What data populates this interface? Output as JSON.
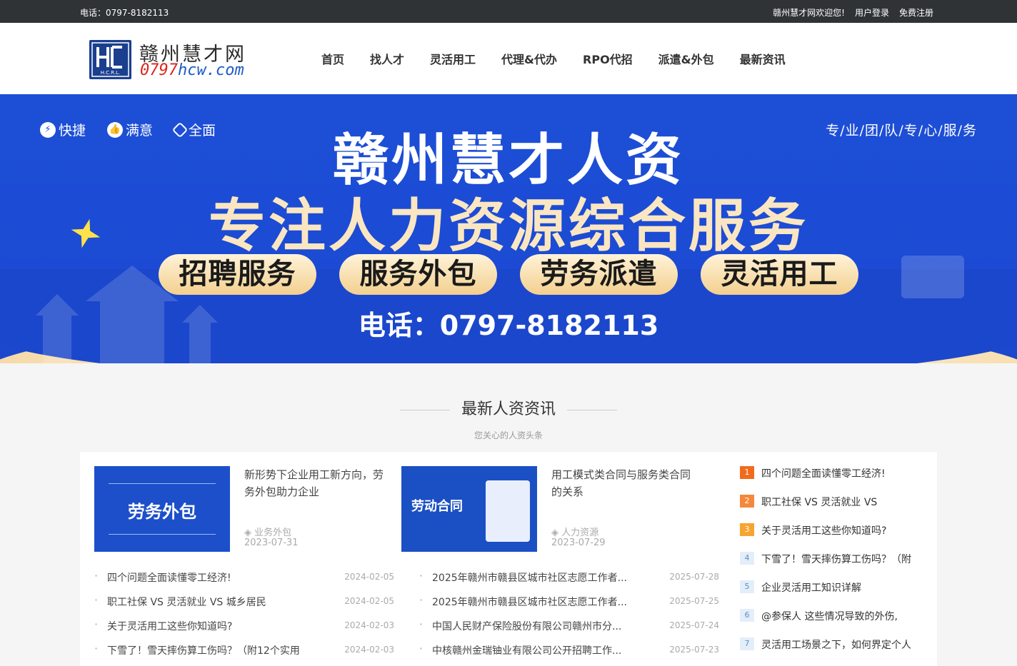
{
  "topbar": {
    "phone": "电话：0797-8182113",
    "welcome": "赣州慧才网欢迎您!",
    "login": "用户登录",
    "register": "免费注册"
  },
  "logo": {
    "cn": "赣州慧才网",
    "en_prefix": "0797",
    "en_suffix": "hcw.com",
    "mark": "H.C.R.L."
  },
  "nav": [
    "首页",
    "找人才",
    "灵活用工",
    "代理&代办",
    "RPO代招",
    "派遣&外包",
    "最新资讯"
  ],
  "banner": {
    "badges": [
      "快捷",
      "满意",
      "全面"
    ],
    "slogan": "专/业/团/队/专/心/服/务",
    "title": "赣州慧才人资",
    "subtitle": "专注人力资源综合服务",
    "services": [
      "招聘服务",
      "服务外包",
      "劳务派遣",
      "灵活用工"
    ],
    "phone": "电话：0797-8182113"
  },
  "section": {
    "title": "最新人资资讯",
    "subtitle": "您关心的人资头条"
  },
  "featured": [
    {
      "thumb_label": "劳务外包",
      "title": "新形势下企业用工新方向，劳务外包助力企业",
      "category": "业务外包",
      "date": "2023-07-31"
    },
    {
      "thumb_label": "劳动合同",
      "title": "用工模式类合同与服务类合同的关系",
      "category": "人力资源",
      "date": "2023-07-29"
    }
  ],
  "list_left": [
    {
      "title": "四个问题全面读懂零工经济!",
      "date": "2024-02-05"
    },
    {
      "title": "职工社保 VS 灵活就业 VS 城乡居民",
      "date": "2024-02-05"
    },
    {
      "title": "关于灵活用工这些你知道吗?",
      "date": "2024-02-03"
    },
    {
      "title": "下雪了！雪天摔伤算工伤吗？（附12个实用",
      "date": "2024-02-03"
    }
  ],
  "list_mid": [
    {
      "title": "2025年赣州市赣县区城市社区志愿工作者...",
      "date": "2025-07-28"
    },
    {
      "title": "2025年赣州市赣县区城市社区志愿工作者...",
      "date": "2025-07-25"
    },
    {
      "title": "中国人民财产保险股份有限公司赣州市分...",
      "date": "2025-07-24"
    },
    {
      "title": "中核赣州金瑞铀业有限公司公开招聘工作...",
      "date": "2025-07-23"
    }
  ],
  "ranking": [
    {
      "n": "1",
      "title": "四个问题全面读懂零工经济!",
      "color": "#f26b1d"
    },
    {
      "n": "2",
      "title": "职工社保 VS 灵活就业 VS",
      "color": "#f5883a"
    },
    {
      "n": "3",
      "title": "关于灵活用工这些你知道吗?",
      "color": "#f7a431"
    },
    {
      "n": "4",
      "title": "下雪了！雪天摔伤算工伤吗？（附",
      "color": "#e3eef9"
    },
    {
      "n": "5",
      "title": "企业灵活用工知识详解",
      "color": "#e3eef9"
    },
    {
      "n": "6",
      "title": "@参保人 这些情况导致的外伤,",
      "color": "#e3eef9"
    },
    {
      "n": "7",
      "title": "灵活用工场景之下，如何界定个人",
      "color": "#e3eef9"
    }
  ]
}
